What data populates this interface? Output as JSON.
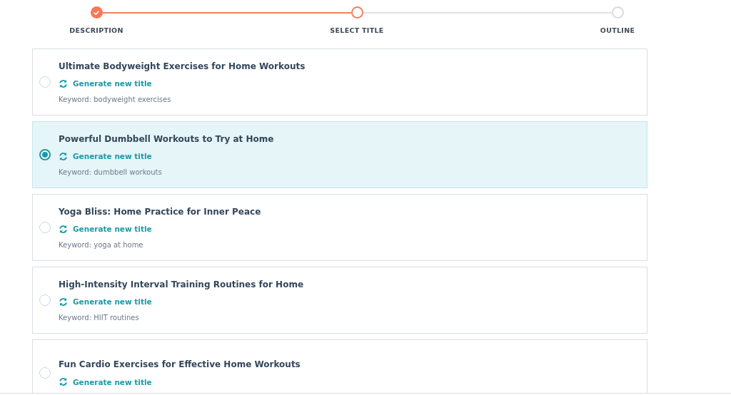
{
  "steps": [
    {
      "label": "DESCRIPTION",
      "kind": "done"
    },
    {
      "label": "SELECT TITLE",
      "kind": "current"
    },
    {
      "label": "OUTLINE",
      "kind": "upcoming"
    }
  ],
  "titles": [
    {
      "title": "Ultimate Bodyweight Exercises for Home Workouts",
      "action": "Generate new title",
      "keyword": "Keyword: bodyweight exercises",
      "selected": false
    },
    {
      "title": "Powerful Dumbbell Workouts to Try at Home",
      "action": "Generate new title",
      "keyword": "Keyword: dumbbell workouts",
      "selected": true
    },
    {
      "title": "Yoga Bliss: Home Practice for Inner Peace",
      "action": "Generate new title",
      "keyword": "Keyword: yoga at home",
      "selected": false
    },
    {
      "title": "High-Intensity Interval Training Routines for Home",
      "action": "Generate new title",
      "keyword": "Keyword: HIIT routines",
      "selected": false
    },
    {
      "title": "Fun Cardio Exercises for Effective Home Workouts",
      "action": "Generate new title",
      "selected": false
    }
  ]
}
